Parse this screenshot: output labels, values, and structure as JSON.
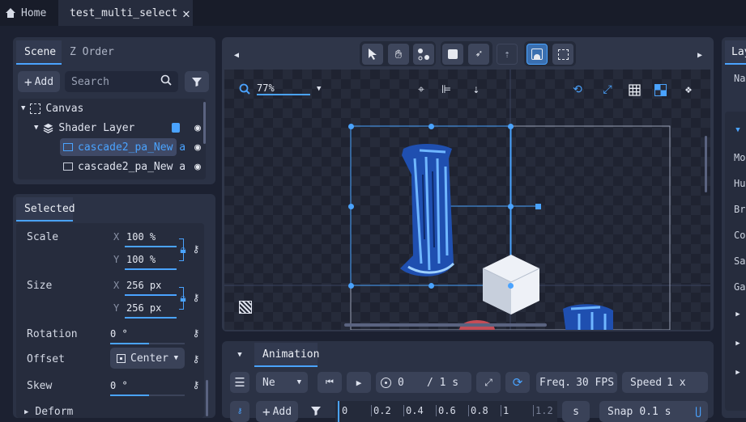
{
  "tabs": {
    "home": "Home",
    "active": "test_multi_select"
  },
  "scene_panel": {
    "tabs": [
      "Scene",
      "Z Order"
    ],
    "add_label": "Add",
    "search_placeholder": "Search",
    "tree": [
      {
        "label": "Canvas"
      },
      {
        "label": "Shader Layer"
      },
      {
        "label": "cascade2_pa_New a"
      },
      {
        "label": "cascade2_pa_New a"
      }
    ]
  },
  "selected_panel": {
    "tab": "Selected",
    "scale": {
      "label": "Scale",
      "x_axis": "X",
      "x": "100 %",
      "y_axis": "Y",
      "y": "100 %"
    },
    "size": {
      "label": "Size",
      "x_axis": "X",
      "x": "256 px",
      "y_axis": "Y",
      "y": "256 px"
    },
    "rotation": {
      "label": "Rotation",
      "value": "0 °"
    },
    "offset": {
      "label": "Offset",
      "value": "Center"
    },
    "skew": {
      "label": "Skew",
      "value": "0 °"
    },
    "deform": {
      "label": "Deform"
    }
  },
  "viewport": {
    "zoom": "77%"
  },
  "animation": {
    "tab": "Animation",
    "mode": "Ne",
    "time": "0",
    "duration": "/ 1 s",
    "freq_label": "Freq.",
    "freq_value": "30 FPS",
    "speed_label": "Speed",
    "speed_value": "1 x",
    "add_label": "Add",
    "ruler": [
      "0",
      "0.2",
      "0.4",
      "0.6",
      "0.8",
      "1",
      "1.2"
    ],
    "unit": "s",
    "snap_label": "Snap",
    "snap_value": "0.1 s"
  },
  "right_panel": {
    "tab": "Lay",
    "labels": [
      "Nam",
      "Mo",
      "Hu",
      "Br",
      "Co",
      "Sa",
      "Ga"
    ]
  },
  "colors": {
    "accent": "#4aa3ff",
    "bg": "#1c2131",
    "panel": "#2b3245"
  }
}
